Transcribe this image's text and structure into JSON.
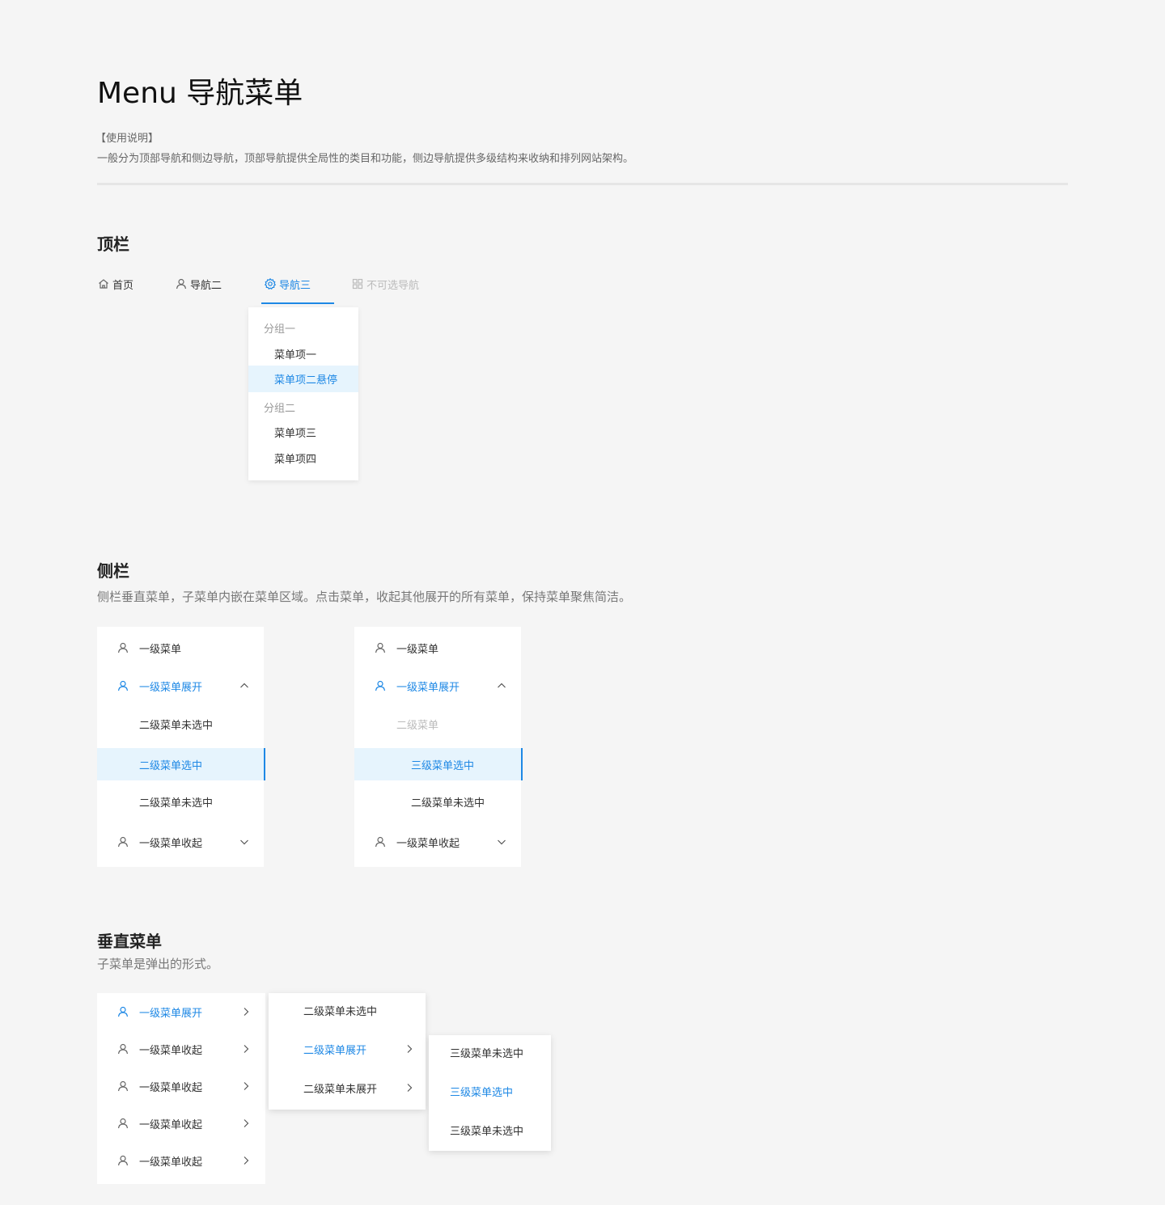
{
  "header": {
    "title": "Menu 导航菜单",
    "usage_label": "【使用说明】",
    "usage_text": "一般分为顶部导航和侧边导航，顶部导航提供全局性的类目和功能，侧边导航提供多级结构来收纳和排列网站架构。"
  },
  "colors": {
    "accent": "#1e88e5",
    "hover_bg": "#e6f4fd",
    "disabled": "#bbbbbb",
    "page_bg": "#f5f5f5"
  },
  "topbar": {
    "title": "顶栏",
    "items": [
      {
        "label": "首页",
        "icon": "home-icon",
        "state": "normal"
      },
      {
        "label": "导航二",
        "icon": "user-icon",
        "state": "normal"
      },
      {
        "label": "导航三",
        "icon": "gear-icon",
        "state": "active"
      },
      {
        "label": "不可选导航",
        "icon": "grid-icon",
        "state": "disabled"
      }
    ],
    "dropdown": {
      "group1": "分组一",
      "item1": "菜单项一",
      "item2": "菜单项二悬停",
      "group2": "分组二",
      "item3": "菜单项三",
      "item4": "菜单项四"
    }
  },
  "sidebar": {
    "title": "侧栏",
    "desc": "侧栏垂直菜单，子菜单内嵌在菜单区域。点击菜单，收起其他展开的所有菜单，保持菜单聚焦简洁。",
    "menu_a": {
      "item1": "一级菜单",
      "item2": "一级菜单展开",
      "sub1": "二级菜单未选中",
      "sub2": "二级菜单选中",
      "sub3": "二级菜单未选中",
      "item3": "一级菜单收起"
    },
    "menu_b": {
      "item1": "一级菜单",
      "item2": "一级菜单展开",
      "sub1": "二级菜单",
      "third1": "三级菜单选中",
      "third2": "二级菜单未选中",
      "item3": "一级菜单收起"
    }
  },
  "vertical": {
    "title": "垂直菜单",
    "desc": "子菜单是弹出的形式。",
    "level1": [
      "一级菜单展开",
      "一级菜单收起",
      "一级菜单收起",
      "一级菜单收起",
      "一级菜单收起"
    ],
    "level2": [
      "二级菜单未选中",
      "二级菜单展开",
      "二级菜单未展开"
    ],
    "level3": [
      "三级菜单未选中",
      "三级菜单选中",
      "三级菜单未选中"
    ]
  }
}
